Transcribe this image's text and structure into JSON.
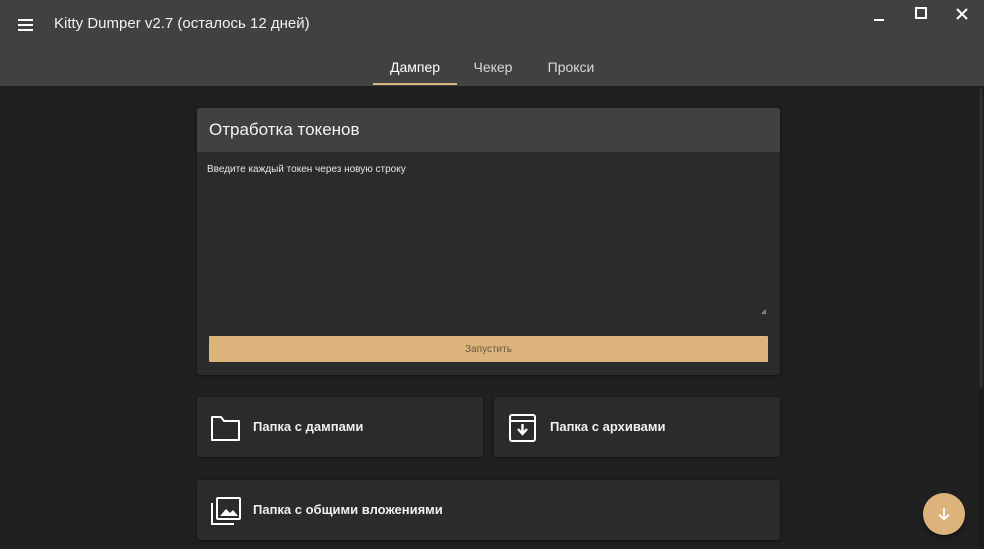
{
  "app": {
    "title": "Kitty Dumper v2.7 (осталось 12 дней)",
    "accent_color": "#dcb37a"
  },
  "window_controls": {
    "minimize_icon": "minimize-icon",
    "maximize_icon": "maximize-icon",
    "close_icon": "close-icon"
  },
  "tabs": [
    {
      "label": "Дампер",
      "active": true
    },
    {
      "label": "Чекер",
      "active": false
    },
    {
      "label": "Прокси",
      "active": false
    }
  ],
  "token_card": {
    "title": "Отработка токенов",
    "textarea_placeholder": "Введите каждый токен через новую строку",
    "textarea_value": "",
    "start_button_label": "Запустить"
  },
  "folders": {
    "dumps": {
      "label": "Папка с дампами",
      "icon": "folder-icon"
    },
    "archives": {
      "label": "Папка с архивами",
      "icon": "archive-icon"
    },
    "attachments": {
      "label": "Папка с общими вложениями",
      "icon": "photo-library-icon"
    }
  },
  "fab": {
    "icon": "arrow-down-icon"
  }
}
